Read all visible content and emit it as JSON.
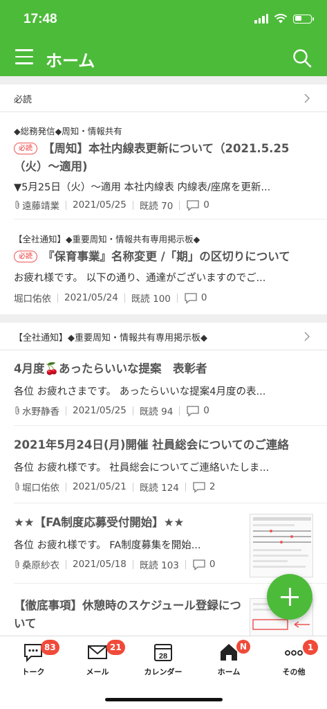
{
  "status": {
    "time": "17:48",
    "battery_level": 0.45
  },
  "app_bar": {
    "title": "ホーム",
    "menu_icon": "hamburger-icon",
    "search_icon": "search-icon"
  },
  "sections": [
    {
      "header": "必読",
      "items": [
        {
          "category": "◆総務発信◆周知・情報共有",
          "badge": "必読",
          "title": "【周知】本社内線表更新について（2021.5.25（火）〜適用)",
          "snippet": "▼5月25日（火）〜適用 本社内線表 内線表/座席を更新...",
          "has_attachment": true,
          "author": "遠藤靖業",
          "date": "2021/05/25",
          "reads": "既読 70",
          "comments": "0"
        },
        {
          "category": "【全社通知】◆重要周知・情報共有専用掲示板◆",
          "badge": "必読",
          "title": "『保育事業』名称変更 /「期」の区切りについて",
          "snippet": "お疲れ様です。 以下の通り、通達がございますのでご...",
          "has_attachment": false,
          "author": "堀口佑依",
          "date": "2021/05/24",
          "reads": "既読 100",
          "comments": "0"
        }
      ]
    },
    {
      "header": "【全社通知】◆重要周知・情報共有専用掲示板◆",
      "items": [
        {
          "title": "4月度🍒あったらいいな提案　表彰者",
          "snippet": "各位 お疲れさまです。 あったらいいな提案4月度の表...",
          "has_attachment": true,
          "author": "水野静香",
          "date": "2021/05/25",
          "reads": "既読 94",
          "comments": "0"
        },
        {
          "title": "2021年5月24日(月)開催 社員総会についてのご連絡",
          "snippet": "各位 お疲れ様です。 社員総会についてご連絡いたしま...",
          "has_attachment": true,
          "author": "堀口佑依",
          "date": "2021/05/21",
          "reads": "既読 124",
          "comments": "2"
        },
        {
          "title": "★★【FA制度応募受付開始】★★",
          "snippet": "各位 お疲れ様です。 FA制度募集を開始...",
          "has_attachment": true,
          "author": "桑原紗衣",
          "date": "2021/05/18",
          "reads": "既読 103",
          "comments": "0"
        },
        {
          "title": "【徹底事項】休憩時のスケジュール登録について"
        }
      ]
    }
  ],
  "fab": {
    "icon": "plus-icon"
  },
  "tabs": [
    {
      "label": "トーク",
      "icon": "chat-icon",
      "badge": "83"
    },
    {
      "label": "メール",
      "icon": "mail-icon",
      "badge": "21"
    },
    {
      "label": "カレンダー",
      "icon": "calendar-icon",
      "badge": "",
      "day": "28"
    },
    {
      "label": "ホーム",
      "icon": "home-icon",
      "badge": "N"
    },
    {
      "label": "その他",
      "icon": "more-icon",
      "badge": "1"
    }
  ],
  "colors": {
    "brand": "#4dbb3a",
    "badge_red": "#f04a3a",
    "must_read": "#e33"
  }
}
